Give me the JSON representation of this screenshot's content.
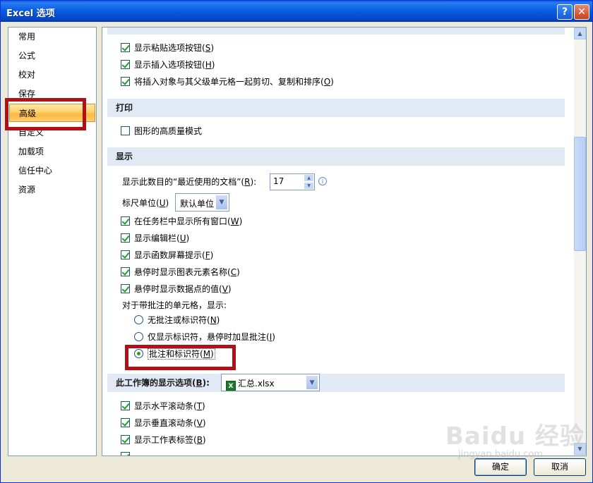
{
  "window": {
    "title": "Excel 选项",
    "help_label": "?",
    "close_label": "✕"
  },
  "nav": {
    "items": [
      {
        "label": "常用"
      },
      {
        "label": "公式"
      },
      {
        "label": "校对"
      },
      {
        "label": "保存"
      },
      {
        "label": "高级",
        "selected": true
      },
      {
        "label": "自定义"
      },
      {
        "label": "加载项"
      },
      {
        "label": "信任中心"
      },
      {
        "label": "资源"
      }
    ]
  },
  "cut_copy": {
    "items": [
      {
        "pre": "显示粘贴选项按钮(",
        "key": "S",
        "post": ")",
        "checked": true
      },
      {
        "pre": "显示插入选项按钮(",
        "key": "H",
        "post": ")",
        "checked": true
      },
      {
        "pre": "将插入对象与其父级单元格一起剪切、复制和排序(",
        "key": "O",
        "post": ")",
        "checked": true
      }
    ]
  },
  "print": {
    "header": "打印",
    "hq_pre": "图形的高质量模式",
    "hq_checked": false
  },
  "display": {
    "header": "显示",
    "recent_pre": "显示此数目的“最近使用的文档”(",
    "recent_key": "R",
    "recent_post": "):",
    "recent_value": "17",
    "ruler_pre": "标尺单位(",
    "ruler_key": "U",
    "ruler_post": ")",
    "ruler_value": "默认单位",
    "items": [
      {
        "pre": "在任务栏中显示所有窗口(",
        "key": "W",
        "post": ")",
        "checked": true
      },
      {
        "pre": "显示编辑栏(",
        "key": "U",
        "post": ")",
        "checked": true
      },
      {
        "pre": "显示函数屏幕提示(",
        "key": "F",
        "post": ")",
        "checked": true
      },
      {
        "pre": "悬停时显示图表元素名称(",
        "key": "C",
        "post": ")",
        "checked": true
      },
      {
        "pre": "悬停时显示数据点的值(",
        "key": "V",
        "post": ")",
        "checked": true
      }
    ],
    "comments_label": "对于带批注的单元格，显示:",
    "radios": [
      {
        "pre": "无批注或标识符(",
        "key": "N",
        "post": ")",
        "checked": false
      },
      {
        "pre": "仅显示标识符，悬停时加显批注(",
        "key": "I",
        "post": ")",
        "checked": false
      },
      {
        "pre": "批注和标识符(",
        "key": "M",
        "post": ")",
        "checked": true
      }
    ]
  },
  "workbook": {
    "header_pre": "此工作簿的显示选项(",
    "header_key": "B",
    "header_post": "):",
    "workbook_value": "汇总.xlsx",
    "xls_icon": "X",
    "items": [
      {
        "pre": "显示水平滚动条(",
        "key": "T",
        "post": ")",
        "checked": true
      },
      {
        "pre": "显示垂直滚动条(",
        "key": "V",
        "post": ")",
        "checked": true
      },
      {
        "pre": "显示工作表标签(",
        "key": "B",
        "post": ")",
        "checked": true
      }
    ]
  },
  "buttons": {
    "ok": "确定",
    "cancel": "取消"
  },
  "scrollbar": {
    "up": "▲",
    "down": "▼"
  },
  "watermark": {
    "text": "Baidu 经验",
    "sub": "jingyan.baidu.com"
  },
  "colors": {
    "title_bar": "#0a5ee4",
    "highlight_red": "#b01016",
    "selected_nav": "#ffc75a",
    "section_header": "#e1e9f5"
  }
}
